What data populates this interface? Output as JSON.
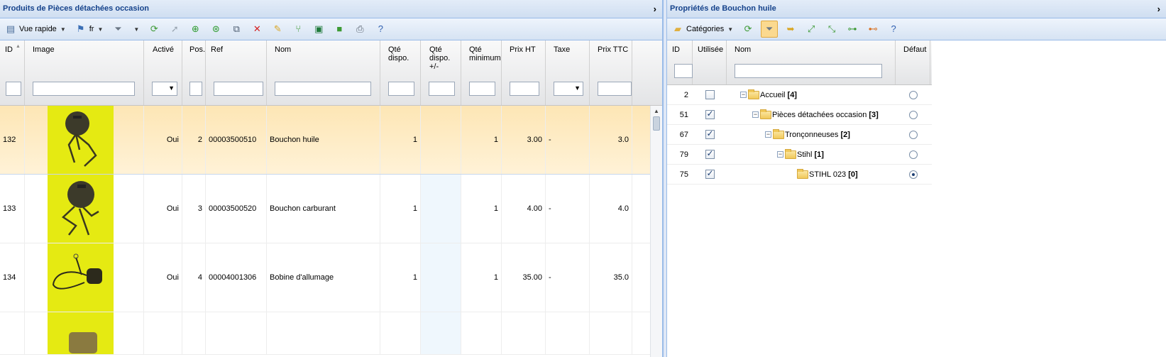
{
  "left": {
    "title": "Produits de Pièces détachées occasion",
    "toolbar": {
      "quick_view_label": "Vue rapide",
      "lang_label": "fr"
    },
    "columns": [
      "ID",
      "Image",
      "Activé",
      "Pos.",
      "Ref",
      "Nom",
      "Qté dispo.",
      "Qté dispo. +/-",
      "Qté minimum",
      "Prix HT",
      "Taxe",
      "Prix TTC"
    ],
    "rows": [
      {
        "id": "132",
        "active": "Oui",
        "pos": "2",
        "ref": "00003500510",
        "name": "Bouchon huile",
        "qty": "1",
        "qty_diff": "",
        "qty_min": "1",
        "price": "3.00",
        "tax": "-",
        "price_ttc": "3.0"
      },
      {
        "id": "133",
        "active": "Oui",
        "pos": "3",
        "ref": "00003500520",
        "name": "Bouchon carburant",
        "qty": "1",
        "qty_diff": "",
        "qty_min": "1",
        "price": "4.00",
        "tax": "-",
        "price_ttc": "4.0"
      },
      {
        "id": "134",
        "active": "Oui",
        "pos": "4",
        "ref": "00004001306",
        "name": "Bobine d'allumage",
        "qty": "1",
        "qty_diff": "",
        "qty_min": "1",
        "price": "35.00",
        "tax": "-",
        "price_ttc": "35.0"
      }
    ]
  },
  "right": {
    "title": "Propriétés de Bouchon huile",
    "toolbar": {
      "categories_label": "Catégories"
    },
    "columns": [
      "ID",
      "Utilisée",
      "Nom",
      "Défaut"
    ],
    "categories": [
      {
        "id": "2",
        "used": false,
        "name": "Accueil",
        "count": "[4]",
        "default": false
      },
      {
        "id": "51",
        "used": true,
        "name": "Pièces détachées occasion",
        "count": "[3]",
        "default": false
      },
      {
        "id": "67",
        "used": true,
        "name": "Tronçonneuses",
        "count": "[2]",
        "default": false
      },
      {
        "id": "79",
        "used": true,
        "name": "Stihl",
        "count": "[1]",
        "default": false
      },
      {
        "id": "75",
        "used": true,
        "name": "STIHL 023",
        "count": "[0]",
        "default": true
      }
    ]
  },
  "colors": {
    "header_text": "#15428b",
    "selected_row": "#fde6b5",
    "thumbnail_bg": "#e5ea12"
  }
}
